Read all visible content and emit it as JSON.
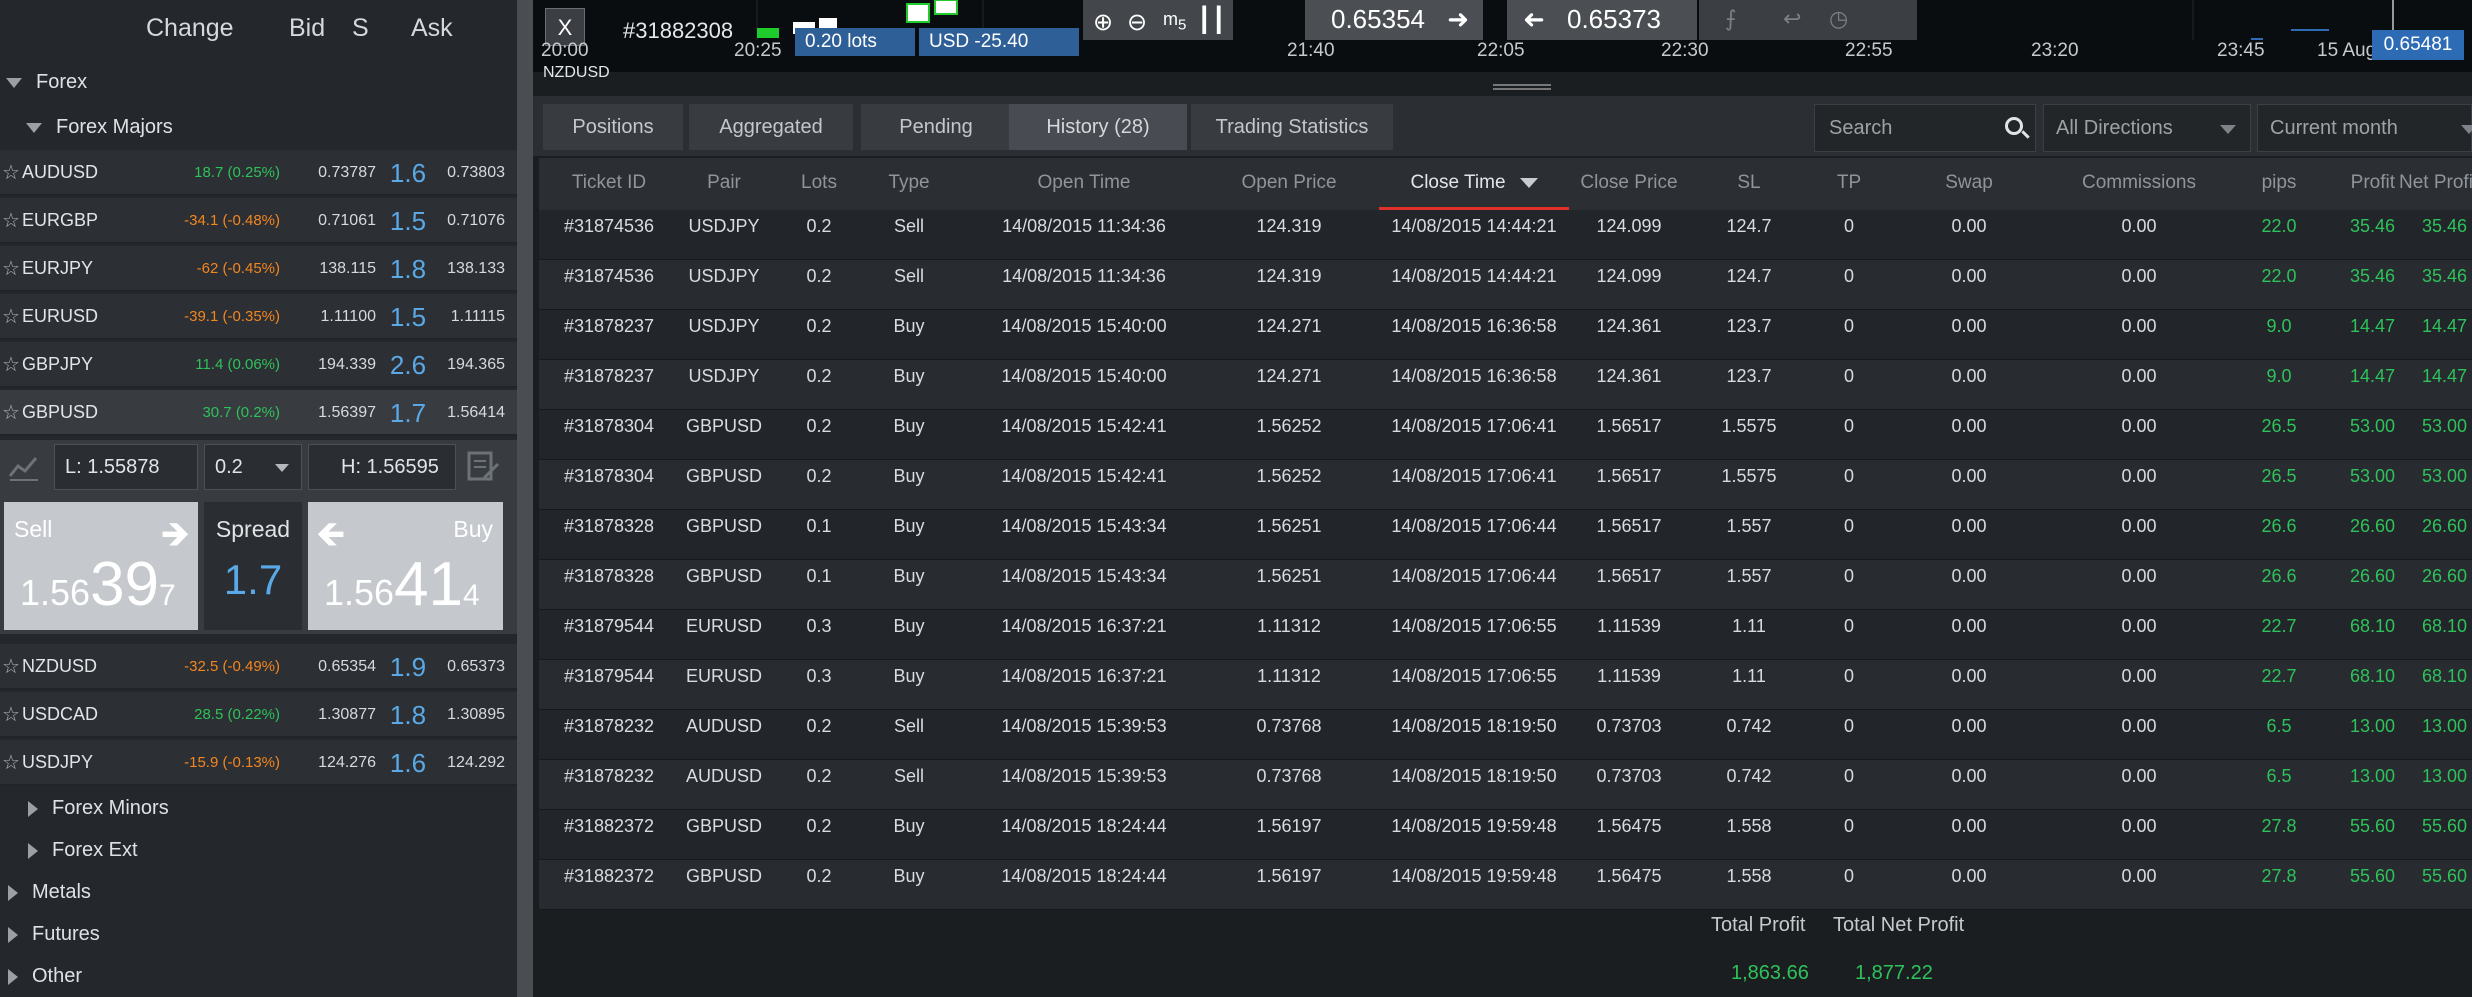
{
  "sidebar": {
    "headers": {
      "change": "Change",
      "bid": "Bid",
      "spread": "S",
      "ask": "Ask"
    },
    "forex_label": "Forex",
    "majors_label": "Forex Majors",
    "pairs": [
      {
        "symbol": "AUDUSD",
        "change": "18.7 (0.25%)",
        "direction": "up",
        "bid": "0.73787",
        "spread": "1.6",
        "ask": "0.73803"
      },
      {
        "symbol": "EURGBP",
        "change": "-34.1 (-0.48%)",
        "direction": "down",
        "bid": "0.71061",
        "spread": "1.5",
        "ask": "0.71076"
      },
      {
        "symbol": "EURJPY",
        "change": "-62 (-0.45%)",
        "direction": "down",
        "bid": "138.115",
        "spread": "1.8",
        "ask": "138.133"
      },
      {
        "symbol": "EURUSD",
        "change": "-39.1 (-0.35%)",
        "direction": "down",
        "bid": "1.11100",
        "spread": "1.5",
        "ask": "1.11115"
      },
      {
        "symbol": "GBPJPY",
        "change": "11.4 (0.06%)",
        "direction": "up",
        "bid": "194.339",
        "spread": "2.6",
        "ask": "194.365"
      },
      {
        "symbol": "GBPUSD",
        "change": "30.7 (0.2%)",
        "direction": "up",
        "bid": "1.56397",
        "spread": "1.7",
        "ask": "1.56414"
      },
      {
        "symbol": "NZDUSD",
        "change": "-32.5 (-0.49%)",
        "direction": "down",
        "bid": "0.65354",
        "spread": "1.9",
        "ask": "0.65373"
      },
      {
        "symbol": "USDCAD",
        "change": "28.5 (0.22%)",
        "direction": "up",
        "bid": "1.30877",
        "spread": "1.8",
        "ask": "1.30895"
      },
      {
        "symbol": "USDJPY",
        "change": "-15.9 (-0.13%)",
        "direction": "down",
        "bid": "124.276",
        "spread": "1.6",
        "ask": "124.292"
      }
    ],
    "expanded": {
      "low": "L: 1.55878",
      "lots": "0.2",
      "high": "H: 1.56595",
      "sell_label": "Sell",
      "sell_price": {
        "a": "1.56",
        "b": "39",
        "c": "7"
      },
      "spread_label": "Spread",
      "spread_value": "1.7",
      "buy_label": "Buy",
      "buy_price": {
        "a": "1.56",
        "b": "41",
        "c": "4"
      }
    },
    "groups": {
      "minors": "Forex Minors",
      "ext": "Forex Ext",
      "metals": "Metals",
      "futures": "Futures",
      "other": "Other"
    }
  },
  "chart": {
    "close_label": "X",
    "ticket": "#31882308",
    "lots_chip": "0.20 lots",
    "pnl_chip": "USD -25.40",
    "sell_price": "0.65354",
    "buy_price": "0.65373",
    "zoom_label": "5",
    "time_axis": [
      "20:00",
      "20:25",
      "21:40",
      "22:05",
      "22:30",
      "22:55",
      "23:20",
      "23:45",
      "15 Aug"
    ],
    "current_price": "0.65481",
    "pair": "NZDUSD"
  },
  "tabs": [
    {
      "label": "Positions",
      "active": false
    },
    {
      "label": "Aggregated",
      "active": false
    },
    {
      "label": "Pending",
      "active": false
    },
    {
      "label": "History (28)",
      "active": true
    },
    {
      "label": "Trading Statistics",
      "active": false
    }
  ],
  "filters": {
    "search_placeholder": "Search",
    "direction": "All Directions",
    "period": "Current month"
  },
  "table": {
    "columns": [
      "Ticket ID",
      "Pair",
      "Lots",
      "Type",
      "Open Time",
      "Open Price",
      "Close Time",
      "Close Price",
      "SL",
      "TP",
      "Swap",
      "Commissions",
      "pips",
      "Profit",
      "Net Profit"
    ],
    "sorted_column": "Close Time",
    "rows": [
      [
        "#31874536",
        "USDJPY",
        "0.2",
        "Sell",
        "14/08/2015 11:34:36",
        "124.319",
        "14/08/2015 14:44:21",
        "124.099",
        "124.7",
        "0",
        "0.00",
        "0.00",
        "22.0",
        "35.46",
        "35.46"
      ],
      [
        "#31874536",
        "USDJPY",
        "0.2",
        "Sell",
        "14/08/2015 11:34:36",
        "124.319",
        "14/08/2015 14:44:21",
        "124.099",
        "124.7",
        "0",
        "0.00",
        "0.00",
        "22.0",
        "35.46",
        "35.46"
      ],
      [
        "#31878237",
        "USDJPY",
        "0.2",
        "Buy",
        "14/08/2015 15:40:00",
        "124.271",
        "14/08/2015 16:36:58",
        "124.361",
        "123.7",
        "0",
        "0.00",
        "0.00",
        "9.0",
        "14.47",
        "14.47"
      ],
      [
        "#31878237",
        "USDJPY",
        "0.2",
        "Buy",
        "14/08/2015 15:40:00",
        "124.271",
        "14/08/2015 16:36:58",
        "124.361",
        "123.7",
        "0",
        "0.00",
        "0.00",
        "9.0",
        "14.47",
        "14.47"
      ],
      [
        "#31878304",
        "GBPUSD",
        "0.2",
        "Buy",
        "14/08/2015 15:42:41",
        "1.56252",
        "14/08/2015 17:06:41",
        "1.56517",
        "1.5575",
        "0",
        "0.00",
        "0.00",
        "26.5",
        "53.00",
        "53.00"
      ],
      [
        "#31878304",
        "GBPUSD",
        "0.2",
        "Buy",
        "14/08/2015 15:42:41",
        "1.56252",
        "14/08/2015 17:06:41",
        "1.56517",
        "1.5575",
        "0",
        "0.00",
        "0.00",
        "26.5",
        "53.00",
        "53.00"
      ],
      [
        "#31878328",
        "GBPUSD",
        "0.1",
        "Buy",
        "14/08/2015 15:43:34",
        "1.56251",
        "14/08/2015 17:06:44",
        "1.56517",
        "1.557",
        "0",
        "0.00",
        "0.00",
        "26.6",
        "26.60",
        "26.60"
      ],
      [
        "#31878328",
        "GBPUSD",
        "0.1",
        "Buy",
        "14/08/2015 15:43:34",
        "1.56251",
        "14/08/2015 17:06:44",
        "1.56517",
        "1.557",
        "0",
        "0.00",
        "0.00",
        "26.6",
        "26.60",
        "26.60"
      ],
      [
        "#31879544",
        "EURUSD",
        "0.3",
        "Buy",
        "14/08/2015 16:37:21",
        "1.11312",
        "14/08/2015 17:06:55",
        "1.11539",
        "1.11",
        "0",
        "0.00",
        "0.00",
        "22.7",
        "68.10",
        "68.10"
      ],
      [
        "#31879544",
        "EURUSD",
        "0.3",
        "Buy",
        "14/08/2015 16:37:21",
        "1.11312",
        "14/08/2015 17:06:55",
        "1.11539",
        "1.11",
        "0",
        "0.00",
        "0.00",
        "22.7",
        "68.10",
        "68.10"
      ],
      [
        "#31878232",
        "AUDUSD",
        "0.2",
        "Sell",
        "14/08/2015 15:39:53",
        "0.73768",
        "14/08/2015 18:19:50",
        "0.73703",
        "0.742",
        "0",
        "0.00",
        "0.00",
        "6.5",
        "13.00",
        "13.00"
      ],
      [
        "#31878232",
        "AUDUSD",
        "0.2",
        "Sell",
        "14/08/2015 15:39:53",
        "0.73768",
        "14/08/2015 18:19:50",
        "0.73703",
        "0.742",
        "0",
        "0.00",
        "0.00",
        "6.5",
        "13.00",
        "13.00"
      ],
      [
        "#31882372",
        "GBPUSD",
        "0.2",
        "Buy",
        "14/08/2015 18:24:44",
        "1.56197",
        "14/08/2015 19:59:48",
        "1.56475",
        "1.558",
        "0",
        "0.00",
        "0.00",
        "27.8",
        "55.60",
        "55.60"
      ],
      [
        "#31882372",
        "GBPUSD",
        "0.2",
        "Buy",
        "14/08/2015 18:24:44",
        "1.56197",
        "14/08/2015 19:59:48",
        "1.56475",
        "1.558",
        "0",
        "0.00",
        "0.00",
        "27.8",
        "55.60",
        "55.60"
      ]
    ]
  },
  "totals": {
    "profit_label": "Total Profit",
    "profit_value": "1,863.66",
    "net_label": "Total Net Profit",
    "net_value": "1,877.22"
  },
  "colors": {
    "positive": "#2ec25a",
    "negative": "#f3861f",
    "accent": "#5aa9e6",
    "sort_underline": "#e0302a"
  }
}
